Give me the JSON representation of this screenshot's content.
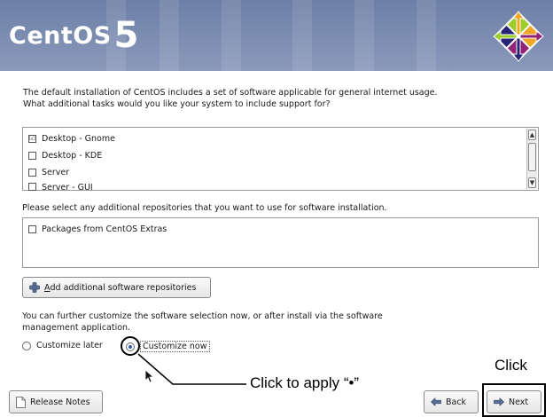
{
  "header": {
    "logo_word": "CentOS",
    "logo_version": "5"
  },
  "intro_text": "The default installation of CentOS includes a set of software applicable for general internet usage. What additional tasks would you like your system to include support for?",
  "tasks": [
    {
      "label": "Desktop - Gnome",
      "checked": true
    },
    {
      "label": "Desktop - KDE",
      "checked": false
    },
    {
      "label": "Server",
      "checked": false
    },
    {
      "label": "Server - GUI",
      "checked": false
    }
  ],
  "repo_prompt": "Please select any additional repositories that you want to use for software installation.",
  "repos": [
    {
      "label": "Packages from CentOS Extras",
      "checked": false
    }
  ],
  "add_repo_button": "Add additional software repositories",
  "add_repo_accel": "A",
  "customize_text": "You can further customize the software selection now, or after install via the software management application.",
  "radio_later": "Customize later",
  "radio_now": "Customize now",
  "selected_radio": "now",
  "buttons": {
    "release_notes": "Release Notes",
    "back": "Back",
    "next": "Next"
  },
  "annotations": {
    "click_to_apply": "Click to apply “•”",
    "click": "Click"
  }
}
